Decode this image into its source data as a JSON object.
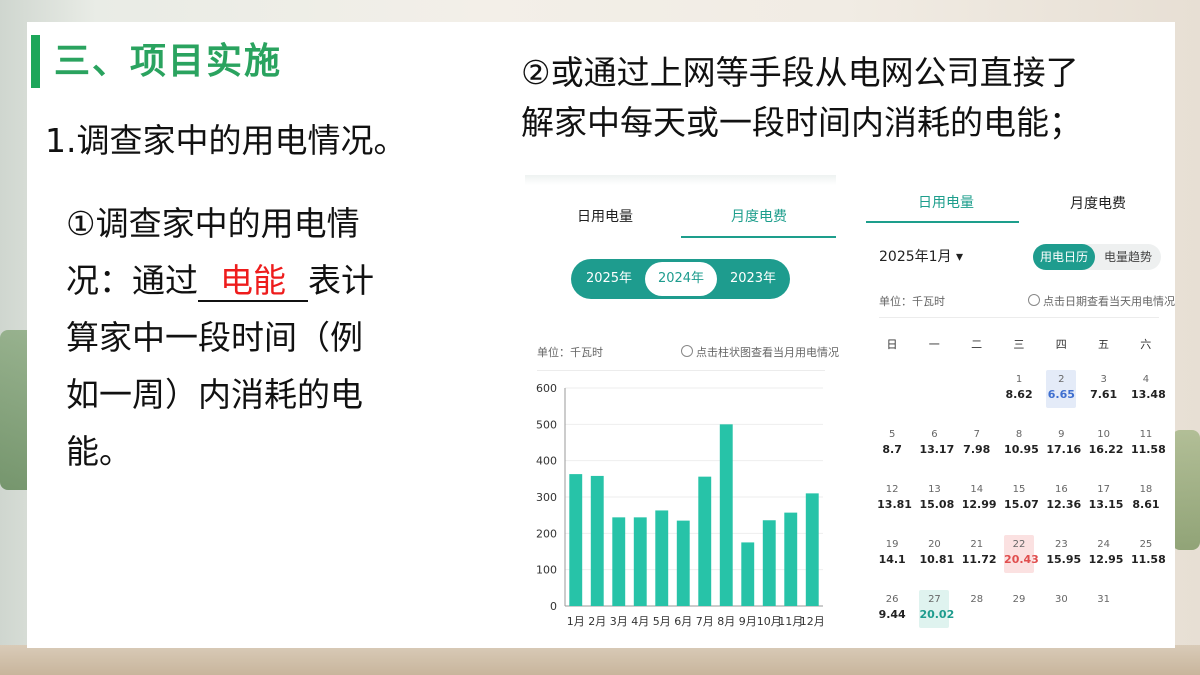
{
  "slide": {
    "title": "三、项目实施",
    "subheading": "1.调查家中的用电情况。",
    "para_line1": "①调查家中的用电情",
    "para_line2_pre": "况：通过",
    "para_blank_answer": "电能",
    "para_line2_post": "表计",
    "para_line3": "算家中一段时间（例",
    "para_line4": "如一周）内消耗的电",
    "para_line5": "能。",
    "right_line1": "②或通过上网等手段从电网公司直接了",
    "right_line2": "解家中每天或一段时间内消耗的电能；"
  },
  "app_monthly": {
    "tabs": [
      "日用电量",
      "月度电费"
    ],
    "active_tab": "月度电费",
    "years": [
      "2025年",
      "2024年",
      "2023年"
    ],
    "selected_year": "2024年",
    "unit_label": "单位：千瓦时",
    "hint": "点击柱状图查看当月用电情况"
  },
  "chart_data": {
    "type": "bar",
    "title": "",
    "xlabel": "",
    "ylabel": "",
    "categories": [
      "1月",
      "2月",
      "3月",
      "4月",
      "5月",
      "6月",
      "7月",
      "8月",
      "9月",
      "10月",
      "11月",
      "12月"
    ],
    "values": [
      363,
      358,
      244,
      244,
      263,
      235,
      356,
      500,
      175,
      236,
      257,
      310
    ],
    "ylim": [
      0,
      600
    ],
    "yticks": [
      0,
      100,
      200,
      300,
      400,
      500,
      600
    ],
    "bar_color": "#27c3a8",
    "grid": true
  },
  "app_calendar": {
    "tabs": [
      "日用电量",
      "月度电费"
    ],
    "active_tab": "日用电量",
    "month_selector": "2025年1月 ▾",
    "toggle": [
      "用电日历",
      "电量趋势"
    ],
    "toggle_active": "用电日历",
    "unit_label": "单位：千瓦时",
    "hint": "点击日期查看当天用电情况",
    "weekdays": [
      "日",
      "一",
      "二",
      "三",
      "四",
      "五",
      "六"
    ],
    "start_weekday": 3,
    "days": [
      {
        "d": "1",
        "v": "8.62"
      },
      {
        "d": "2",
        "v": "6.65",
        "hl": "blue"
      },
      {
        "d": "3",
        "v": "7.61"
      },
      {
        "d": "4",
        "v": "13.48"
      },
      {
        "d": "5",
        "v": "8.7"
      },
      {
        "d": "6",
        "v": "13.17"
      },
      {
        "d": "7",
        "v": "7.98"
      },
      {
        "d": "8",
        "v": "10.95"
      },
      {
        "d": "9",
        "v": "17.16"
      },
      {
        "d": "10",
        "v": "16.22"
      },
      {
        "d": "11",
        "v": "11.58"
      },
      {
        "d": "12",
        "v": "13.81"
      },
      {
        "d": "13",
        "v": "15.08"
      },
      {
        "d": "14",
        "v": "12.99"
      },
      {
        "d": "15",
        "v": "15.07"
      },
      {
        "d": "16",
        "v": "12.36"
      },
      {
        "d": "17",
        "v": "13.15"
      },
      {
        "d": "18",
        "v": "8.61"
      },
      {
        "d": "19",
        "v": "14.1"
      },
      {
        "d": "20",
        "v": "10.81"
      },
      {
        "d": "21",
        "v": "11.72"
      },
      {
        "d": "22",
        "v": "20.43",
        "hl": "red"
      },
      {
        "d": "23",
        "v": "15.95"
      },
      {
        "d": "24",
        "v": "12.95"
      },
      {
        "d": "25",
        "v": "11.58"
      },
      {
        "d": "26",
        "v": "9.44"
      },
      {
        "d": "27",
        "v": "20.02",
        "hl": "green"
      },
      {
        "d": "28",
        "v": ""
      },
      {
        "d": "29",
        "v": ""
      },
      {
        "d": "30",
        "v": ""
      },
      {
        "d": "31",
        "v": ""
      }
    ]
  }
}
